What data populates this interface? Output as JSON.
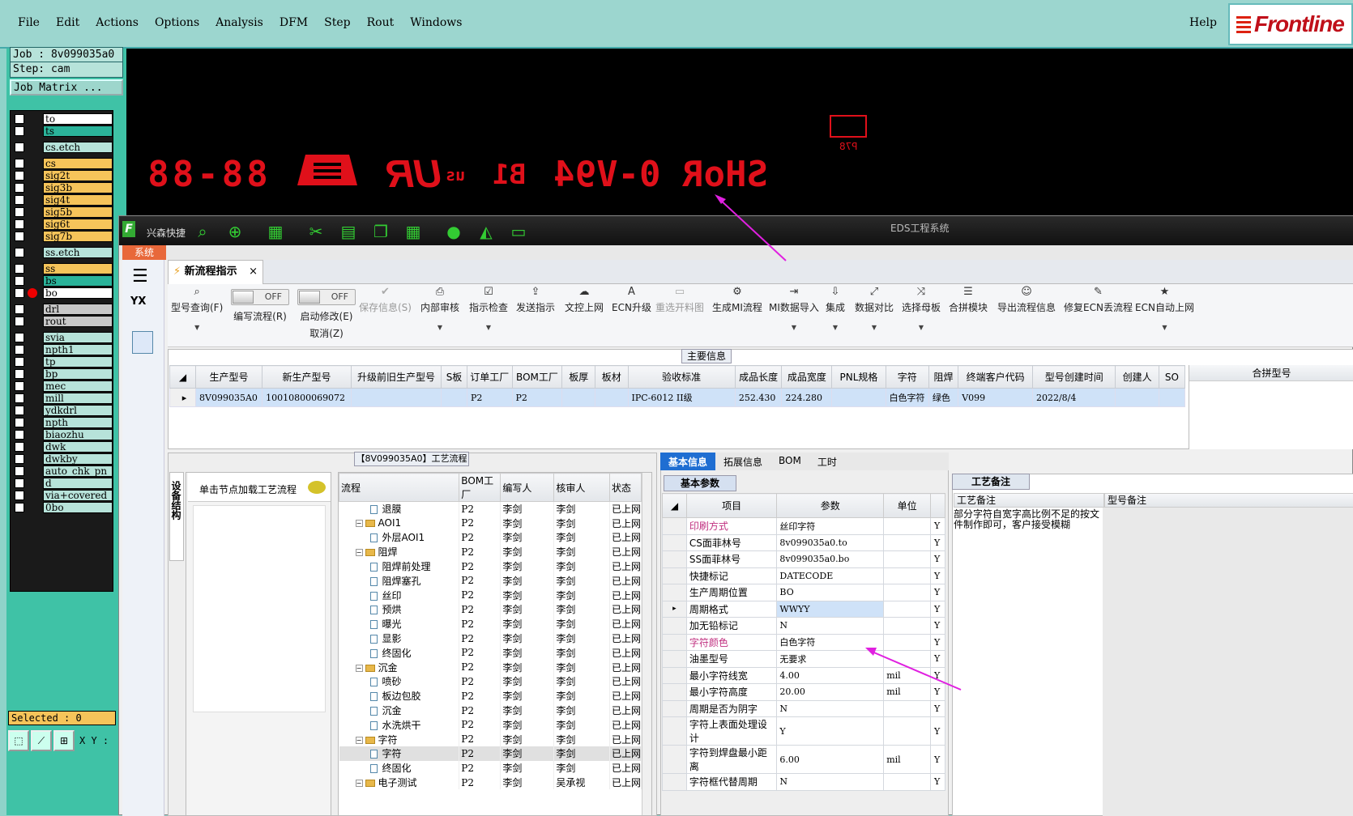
{
  "menu": [
    "File",
    "Edit",
    "Actions",
    "Options",
    "Analysis",
    "DFM",
    "Step",
    "Rout",
    "Windows"
  ],
  "help": "Help",
  "logo": "Frontline",
  "job": {
    "job": "Job : 8v099035a0",
    "step": "Step: cam",
    "matrix": "Job Matrix ..."
  },
  "layers": [
    {
      "name": "to",
      "color": "#ffffff"
    },
    {
      "name": "ts",
      "color": "#2bb39a"
    },
    {
      "name": "cs.etch",
      "color": "#b7e3da"
    },
    {
      "name": "cs",
      "color": "#f6c45a"
    },
    {
      "name": "sig2t",
      "color": "#f6c45a"
    },
    {
      "name": "sig3b",
      "color": "#f6c45a"
    },
    {
      "name": "sig4t",
      "color": "#f6c45a"
    },
    {
      "name": "sig5b",
      "color": "#f6c45a"
    },
    {
      "name": "sig6t",
      "color": "#f6c45a"
    },
    {
      "name": "sig7b",
      "color": "#f6c45a"
    },
    {
      "name": "ss.etch",
      "color": "#b7e3da"
    },
    {
      "name": "ss",
      "color": "#f6c45a"
    },
    {
      "name": "bs",
      "color": "#2bb39a"
    },
    {
      "name": "bo",
      "color": "#ffffff"
    },
    {
      "name": "drl",
      "color": "#c8c8c8"
    },
    {
      "name": "rout",
      "color": "#c8c8c8"
    },
    {
      "name": "svia",
      "color": "#b7e3da"
    },
    {
      "name": "npth1",
      "color": "#b7e3da"
    },
    {
      "name": "tp",
      "color": "#b7e3da"
    },
    {
      "name": "bp",
      "color": "#b7e3da"
    },
    {
      "name": "mec",
      "color": "#b7e3da"
    },
    {
      "name": "mill",
      "color": "#b7e3da"
    },
    {
      "name": "ydkdrl",
      "color": "#b7e3da"
    },
    {
      "name": "npth",
      "color": "#b7e3da"
    },
    {
      "name": "biaozhu",
      "color": "#b7e3da"
    },
    {
      "name": "dwk",
      "color": "#b7e3da"
    },
    {
      "name": "dwkby",
      "color": "#b7e3da"
    },
    {
      "name": "auto_chk_pn",
      "color": "#b7e3da"
    },
    {
      "name": "d",
      "color": "#b7e3da"
    },
    {
      "name": "via+covered",
      "color": "#b7e3da"
    },
    {
      "name": "0bo",
      "color": "#b7e3da"
    }
  ],
  "selected": "Selected : 0",
  "xy": "X Y :",
  "canvas": {
    "text1": "SHoR 0-V94",
    "text2": "B1",
    "text3": "us",
    "logo": "UR",
    "date": "88-88",
    "code": "P78"
  },
  "eds": {
    "title": "EDS工程系统",
    "sub": "兴森快捷",
    "sys_tab": "系统",
    "doc_tab": "新流程指示",
    "yx": "YX"
  },
  "toolbar": [
    {
      "icon": "⌕",
      "label": "型号查询(F)",
      "dd": true
    },
    {
      "icon": "",
      "label": "编写流程(R)",
      "toggle": "OFF"
    },
    {
      "icon": "",
      "label": "启动修改(E)",
      "sub": "取消(Z)",
      "toggle": "OFF"
    },
    {
      "icon": "✔",
      "label": "保存信息(S)",
      "disabled": true
    },
    {
      "icon": "⎙",
      "label": "内部审核",
      "dd": true
    },
    {
      "icon": "☑",
      "label": "指示检查",
      "dd": true
    },
    {
      "icon": "⇪",
      "label": "发送指示"
    },
    {
      "icon": "☁",
      "label": "文控上网"
    },
    {
      "icon": "A",
      "label": "ECN升级"
    },
    {
      "icon": "▭",
      "label": "重选开料图",
      "disabled": true
    },
    {
      "icon": "⚙",
      "label": "生成MI流程"
    },
    {
      "icon": "⇥",
      "label": "MI数据导入",
      "dd": true
    },
    {
      "icon": "⇩",
      "label": "集成",
      "dd": true
    },
    {
      "icon": "⤢",
      "label": "数据对比",
      "dd": true
    },
    {
      "icon": "⤨",
      "label": "选择母板",
      "dd": true
    },
    {
      "icon": "☰",
      "label": "合拼模块"
    },
    {
      "icon": "☺",
      "label": "导出流程信息"
    },
    {
      "icon": "✎",
      "label": "修复ECN丢流程"
    },
    {
      "icon": "★",
      "label": "ECN自动上网",
      "dd": true
    }
  ],
  "main_info": {
    "label": "主要信息",
    "headers": [
      "生产型号",
      "新生产型号",
      "升级前旧生产型号",
      "S板",
      "订单工厂",
      "BOM工厂",
      "板厚",
      "板材",
      "验收标准",
      "成品长度",
      "成品宽度",
      "PNL规格",
      "字符",
      "阻焊",
      "终端客户代码",
      "型号创建时间",
      "创建人",
      "SO"
    ],
    "row": [
      "8V099035A0",
      "10010800069072",
      "",
      "",
      "P2",
      "P2",
      "",
      "",
      "IPC-6012 II级",
      "252.430",
      "224.280",
      "",
      "白色字符",
      "绿色",
      "V099",
      "2022/8/4",
      "",
      ""
    ],
    "merge_header": "合拼型号"
  },
  "process": {
    "label": "【8V099035A0】工艺流程",
    "vtab": "设备结构",
    "hint": "单击节点加载工艺流程",
    "headers": [
      "流程",
      "BOM工厂",
      "编写人",
      "核审人",
      "状态"
    ],
    "rows": [
      {
        "name": "退膜",
        "lvl": 2,
        "type": "doc",
        "bom": "P2",
        "w": "李剑",
        "r": "李剑",
        "s": "已上网"
      },
      {
        "name": "AOI1",
        "lvl": 1,
        "type": "fold",
        "bom": "P2",
        "w": "李剑",
        "r": "李剑",
        "s": "已上网"
      },
      {
        "name": "外层AOI1",
        "lvl": 2,
        "type": "doc",
        "bom": "P2",
        "w": "李剑",
        "r": "李剑",
        "s": "已上网"
      },
      {
        "name": "阻焊",
        "lvl": 1,
        "type": "fold",
        "bom": "P2",
        "w": "李剑",
        "r": "李剑",
        "s": "已上网"
      },
      {
        "name": "阻焊前处理",
        "lvl": 2,
        "type": "doc",
        "bom": "P2",
        "w": "李剑",
        "r": "李剑",
        "s": "已上网"
      },
      {
        "name": "阻焊塞孔",
        "lvl": 2,
        "type": "doc",
        "bom": "P2",
        "w": "李剑",
        "r": "李剑",
        "s": "已上网"
      },
      {
        "name": "丝印",
        "lvl": 2,
        "type": "doc",
        "bom": "P2",
        "w": "李剑",
        "r": "李剑",
        "s": "已上网"
      },
      {
        "name": "预烘",
        "lvl": 2,
        "type": "doc",
        "bom": "P2",
        "w": "李剑",
        "r": "李剑",
        "s": "已上网"
      },
      {
        "name": "曝光",
        "lvl": 2,
        "type": "doc",
        "bom": "P2",
        "w": "李剑",
        "r": "李剑",
        "s": "已上网"
      },
      {
        "name": "显影",
        "lvl": 2,
        "type": "doc",
        "bom": "P2",
        "w": "李剑",
        "r": "李剑",
        "s": "已上网"
      },
      {
        "name": "终固化",
        "lvl": 2,
        "type": "doc",
        "bom": "P2",
        "w": "李剑",
        "r": "李剑",
        "s": "已上网"
      },
      {
        "name": "沉金",
        "lvl": 1,
        "type": "fold",
        "bom": "P2",
        "w": "李剑",
        "r": "李剑",
        "s": "已上网"
      },
      {
        "name": "喷砂",
        "lvl": 2,
        "type": "doc",
        "bom": "P2",
        "w": "李剑",
        "r": "李剑",
        "s": "已上网"
      },
      {
        "name": "板边包胶",
        "lvl": 2,
        "type": "doc",
        "bom": "P2",
        "w": "李剑",
        "r": "李剑",
        "s": "已上网"
      },
      {
        "name": "沉金",
        "lvl": 2,
        "type": "doc",
        "bom": "P2",
        "w": "李剑",
        "r": "李剑",
        "s": "已上网"
      },
      {
        "name": "水洗烘干",
        "lvl": 2,
        "type": "doc",
        "bom": "P2",
        "w": "李剑",
        "r": "李剑",
        "s": "已上网"
      },
      {
        "name": "字符",
        "lvl": 1,
        "type": "fold",
        "bom": "P2",
        "w": "李剑",
        "r": "李剑",
        "s": "已上网"
      },
      {
        "name": "字符",
        "lvl": 2,
        "type": "doc",
        "bom": "P2",
        "w": "李剑",
        "r": "李剑",
        "s": "已上网",
        "sel": true
      },
      {
        "name": "终固化",
        "lvl": 2,
        "type": "doc",
        "bom": "P2",
        "w": "李剑",
        "r": "李剑",
        "s": "已上网"
      },
      {
        "name": "电子测试",
        "lvl": 1,
        "type": "fold",
        "bom": "P2",
        "w": "李剑",
        "r": "吴承视",
        "s": "已上网"
      }
    ]
  },
  "basic": {
    "tabs": [
      "基本信息",
      "拓展信息",
      "BOM",
      "工时"
    ],
    "param_label": "基本参数",
    "headers": [
      "项目",
      "参数",
      "单位"
    ],
    "rows": [
      {
        "k": "印刷方式",
        "v": "丝印字符",
        "u": "",
        "f": "Y",
        "c": "#c03080"
      },
      {
        "k": "CS面菲林号",
        "v": "8v099035a0.to",
        "u": "",
        "f": "Y"
      },
      {
        "k": "SS面菲林号",
        "v": "8v099035a0.bo",
        "u": "",
        "f": "Y"
      },
      {
        "k": "快捷标记",
        "v": "DATECODE",
        "u": "",
        "f": "Y"
      },
      {
        "k": "生产周期位置",
        "v": "BO",
        "u": "",
        "f": "Y"
      },
      {
        "k": "周期格式",
        "v": "WWYY",
        "u": "",
        "f": "Y",
        "sel": true
      },
      {
        "k": "加无铅标记",
        "v": "N",
        "u": "",
        "f": "Y"
      },
      {
        "k": "字符颜色",
        "v": "白色字符",
        "u": "",
        "f": "Y",
        "c": "#c03080"
      },
      {
        "k": "油墨型号",
        "v": "无要求",
        "u": "",
        "f": "Y"
      },
      {
        "k": "最小字符线宽",
        "v": "4.00",
        "u": "mil",
        "f": "Y"
      },
      {
        "k": "最小字符高度",
        "v": "20.00",
        "u": "mil",
        "f": "Y"
      },
      {
        "k": "周期是否为阴字",
        "v": "N",
        "u": "",
        "f": "Y"
      },
      {
        "k": "字符上表面处理设计",
        "v": "Y",
        "u": "",
        "f": "Y"
      },
      {
        "k": "字符到焊盘最小距离",
        "v": "6.00",
        "u": "mil",
        "f": "Y"
      },
      {
        "k": "字符框代替周期",
        "v": "N",
        "u": "",
        "f": "Y"
      }
    ]
  },
  "notes": {
    "label": "工艺备注",
    "headers": [
      "工艺备注",
      "型号备注"
    ],
    "text": "部分字符自宽字高比例不足的按文件制作即可，客户接受模糊"
  }
}
